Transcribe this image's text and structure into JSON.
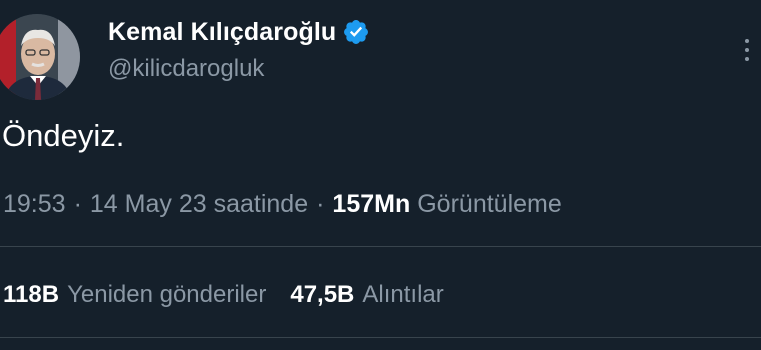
{
  "author": {
    "display_name": "Kemal Kılıçdaroğlu",
    "handle": "@kilicdarogluk",
    "verified_icon": "verified-badge-icon",
    "avatar_icon": "profile-avatar"
  },
  "menu": {
    "icon": "more-vertical-icon"
  },
  "tweet": {
    "text": "Öndeyiz.",
    "time": "19:53",
    "separator": "·",
    "date_label": "14 May 23 saatinde",
    "views_count": "157Mn",
    "views_label": "Görüntüleme"
  },
  "stats": {
    "retweets_count": "118B",
    "retweets_label": "Yeniden gönderiler",
    "quotes_count": "47,5B",
    "quotes_label": "Alıntılar"
  },
  "colors": {
    "background": "#15202b",
    "primary_text": "#ffffff",
    "secondary_text": "#8b98a5",
    "verified_blue": "#1d9bf0",
    "divider": "#38444d"
  }
}
